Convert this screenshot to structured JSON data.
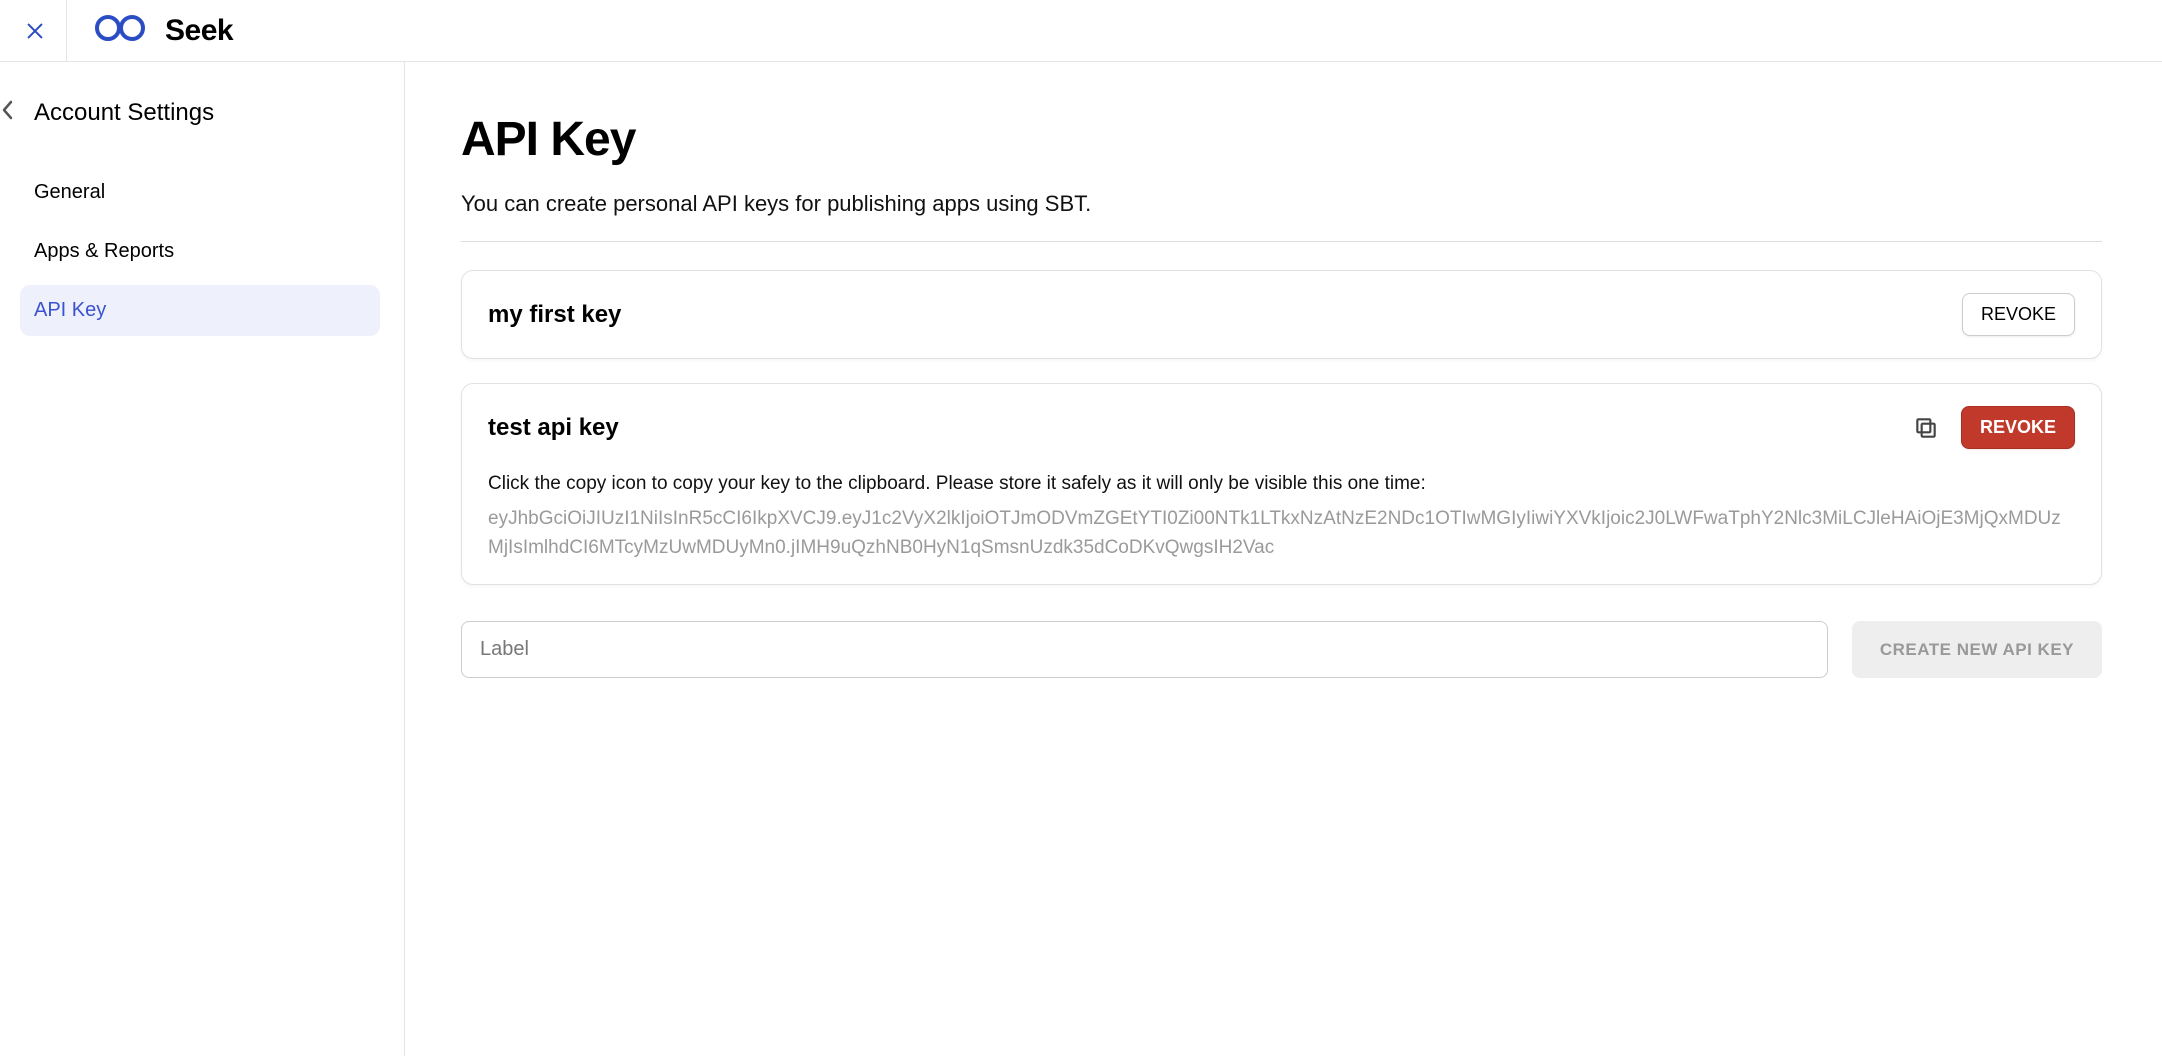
{
  "brand": {
    "name": "Seek"
  },
  "sidebar": {
    "title": "Account Settings",
    "items": [
      {
        "label": "General",
        "active": false
      },
      {
        "label": "Apps & Reports",
        "active": false
      },
      {
        "label": "API Key",
        "active": true
      }
    ]
  },
  "page": {
    "title": "API Key",
    "subtitle": "You can create personal API keys for publishing apps using SBT."
  },
  "keys": [
    {
      "name": "my first key",
      "revoke_label": "REVOKE",
      "show_copy": false,
      "danger": false
    },
    {
      "name": "test api key",
      "revoke_label": "REVOKE",
      "show_copy": true,
      "danger": true,
      "instruction": "Click the copy icon to copy your key to the clipboard. Please store it safely as it will only be visible this one time:",
      "token": "eyJhbGciOiJIUzI1NiIsInR5cCI6IkpXVCJ9.eyJ1c2VyX2lkIjoiOTJmODVmZGEtYTI0Zi00NTk1LTkxNzAtNzE2NDc1OTIwMGIyIiwiYXVkIjoic2J0LWFwaTphY2Nlc3MiLCJleHAiOjE3MjQxMDUzMjIsImlhdCI6MTcyMzUwMDUyMn0.jIMH9uQzhNB0HyN1qSmsnUzdk35dCoDKvQwgsIH2Vac"
    }
  ],
  "create": {
    "placeholder": "Label",
    "button": "CREATE NEW API KEY"
  }
}
